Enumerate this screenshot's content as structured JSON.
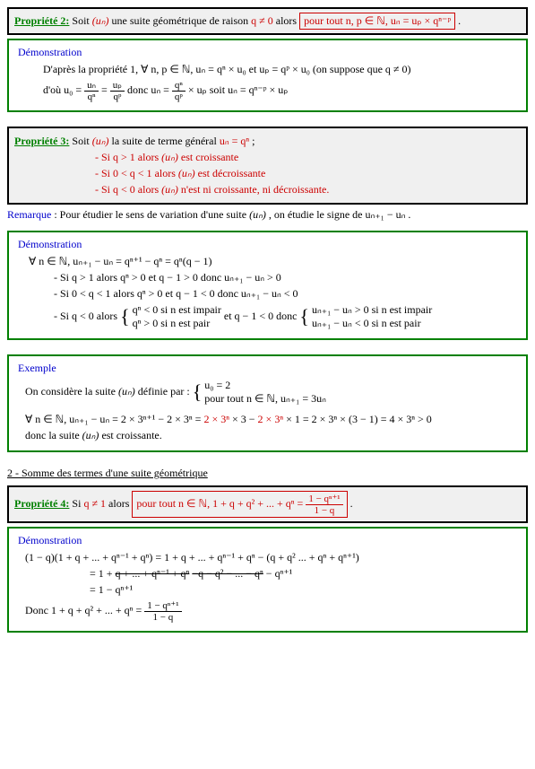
{
  "prop2": {
    "title": "Propriété 2:",
    "intro": " Soit ",
    "un": "(uₙ)",
    "text1": " une suite géométrique de raison ",
    "qneq": "q ≠ 0",
    "text2": "  alors ",
    "box": "pour tout n, p ∈ ℕ,  uₙ = uₚ × qⁿ⁻ᵖ",
    "dot": " ."
  },
  "demo2": {
    "title": "Démonstration",
    "l1a": "D'après la propriété 1, ∀ n, p ∈ ℕ,  uₙ = qⁿ × u₀    et    uₚ = qᵖ × u₀   (on suppose que q ≠ 0)",
    "l2a": "d'où   u₀ = ",
    "f1num": "uₙ",
    "f1den": "qⁿ",
    "eq": " = ",
    "f2num": "uₚ",
    "f2den": "qᵖ",
    "l2b": "    donc    uₙ = ",
    "f3num": "qⁿ",
    "f3den": "qᵖ",
    "l2c": " × uₚ    soit    uₙ = qⁿ⁻ᵖ × uₚ"
  },
  "prop3": {
    "title": "Propriété 3:",
    "intro": " Soit ",
    "un": "(uₙ)",
    "text1": " la suite de terme général ",
    "eq": "uₙ = qⁿ",
    "semi": " ;",
    "c1a": "- Si  ",
    "c1b": "q > 1",
    "c1c": "  alors ",
    "c1d": "(uₙ)",
    "c1e": "  est croissante",
    "c2a": "- Si  ",
    "c2b": "0 < q < 1",
    "c2c": "  alors ",
    "c2d": "(uₙ)",
    "c2e": "  est décroissante",
    "c3a": "- Si  ",
    "c3b": "q < 0",
    "c3c": "  alors ",
    "c3d": "(uₙ)",
    "c3e": "  n'est ni croissante, ni décroissante."
  },
  "remark": {
    "title": "Remarque",
    "text1": " : Pour étudier le sens de variation d'une suite ",
    "un": "(uₙ)",
    "text2": " , on étudie le signe de  ",
    "expr": "uₙ₊₁ − uₙ",
    "dot": " ."
  },
  "demo3": {
    "title": "Démonstration",
    "l1": "∀ n ∈ ℕ,  uₙ₊₁ − uₙ = qⁿ⁺¹ − qⁿ = qⁿ(q − 1)",
    "c1": "- Si  q > 1  alors  qⁿ > 0  et  q − 1 > 0   donc   uₙ₊₁ − uₙ > 0",
    "c2": "- Si  0 < q < 1  alors  qⁿ > 0  et  q − 1 < 0   donc   uₙ₊₁ − uₙ < 0",
    "c3a": "- Si  q < 0  alors ",
    "b1l1": "qⁿ < 0   si n est impair",
    "b1l2": "qⁿ > 0   si n est pair",
    "c3b": "   et   q − 1 < 0   donc   ",
    "b2l1": "uₙ₊₁ − uₙ > 0  si  n est impair",
    "b2l2": "uₙ₊₁ − uₙ < 0  si  n est pair"
  },
  "example": {
    "title": "Exemple",
    "l1a": "On considère la suite ",
    "un": "(uₙ)",
    "l1b": "  définie par : ",
    "b1": "u₀ = 2",
    "b2": "pour tout n ∈ ℕ,  uₙ₊₁ = 3uₙ",
    "l2a": "∀ n ∈ ℕ, uₙ₊₁ − uₙ = 2 × 3ⁿ⁺¹ − 2 × 3ⁿ = ",
    "l2r1": "2 × 3ⁿ",
    "l2m1": " × 3 − ",
    "l2r2": "2 × 3ⁿ",
    "l2m2": " × 1 = 2 × 3ⁿ × (3 − 1) = 4 × 3ⁿ > 0",
    "l3a": "donc la suite ",
    "l3b": "(uₙ)",
    "l3c": "  est croissante."
  },
  "section2": "2 - Somme des termes d'une suite géométrique",
  "prop4": {
    "title": "Propriété 4:",
    "intro": " Si  ",
    "cond": "q ≠ 1",
    "text1": "  alors ",
    "boxa": "pour tout n ∈ ℕ,  1 + q + q² + ... + qⁿ = ",
    "fnum": "1 − qⁿ⁺¹",
    "fden": "1 − q",
    "dot": " ."
  },
  "demo4": {
    "title": "Démonstration",
    "l1": "(1 − q)(1 + q + ... + qⁿ⁻¹ + qⁿ) = 1 + q + ... + qⁿ⁻¹ + qⁿ − (q + q² ... + qⁿ + qⁿ⁺¹)",
    "l2a": "= 1 + ",
    "l2s1": "q + ... + qⁿ⁻¹ + qⁿ",
    "l2m": "  ",
    "l2s2": "−q − q² − ... − qⁿ",
    "l2b": " − qⁿ⁺¹",
    "l3": "= 1 − qⁿ⁺¹",
    "l4a": "Donc  1 + q + q² + ... + qⁿ = ",
    "f1num": "1 − qⁿ⁺¹",
    "f1den": "1 − q"
  }
}
